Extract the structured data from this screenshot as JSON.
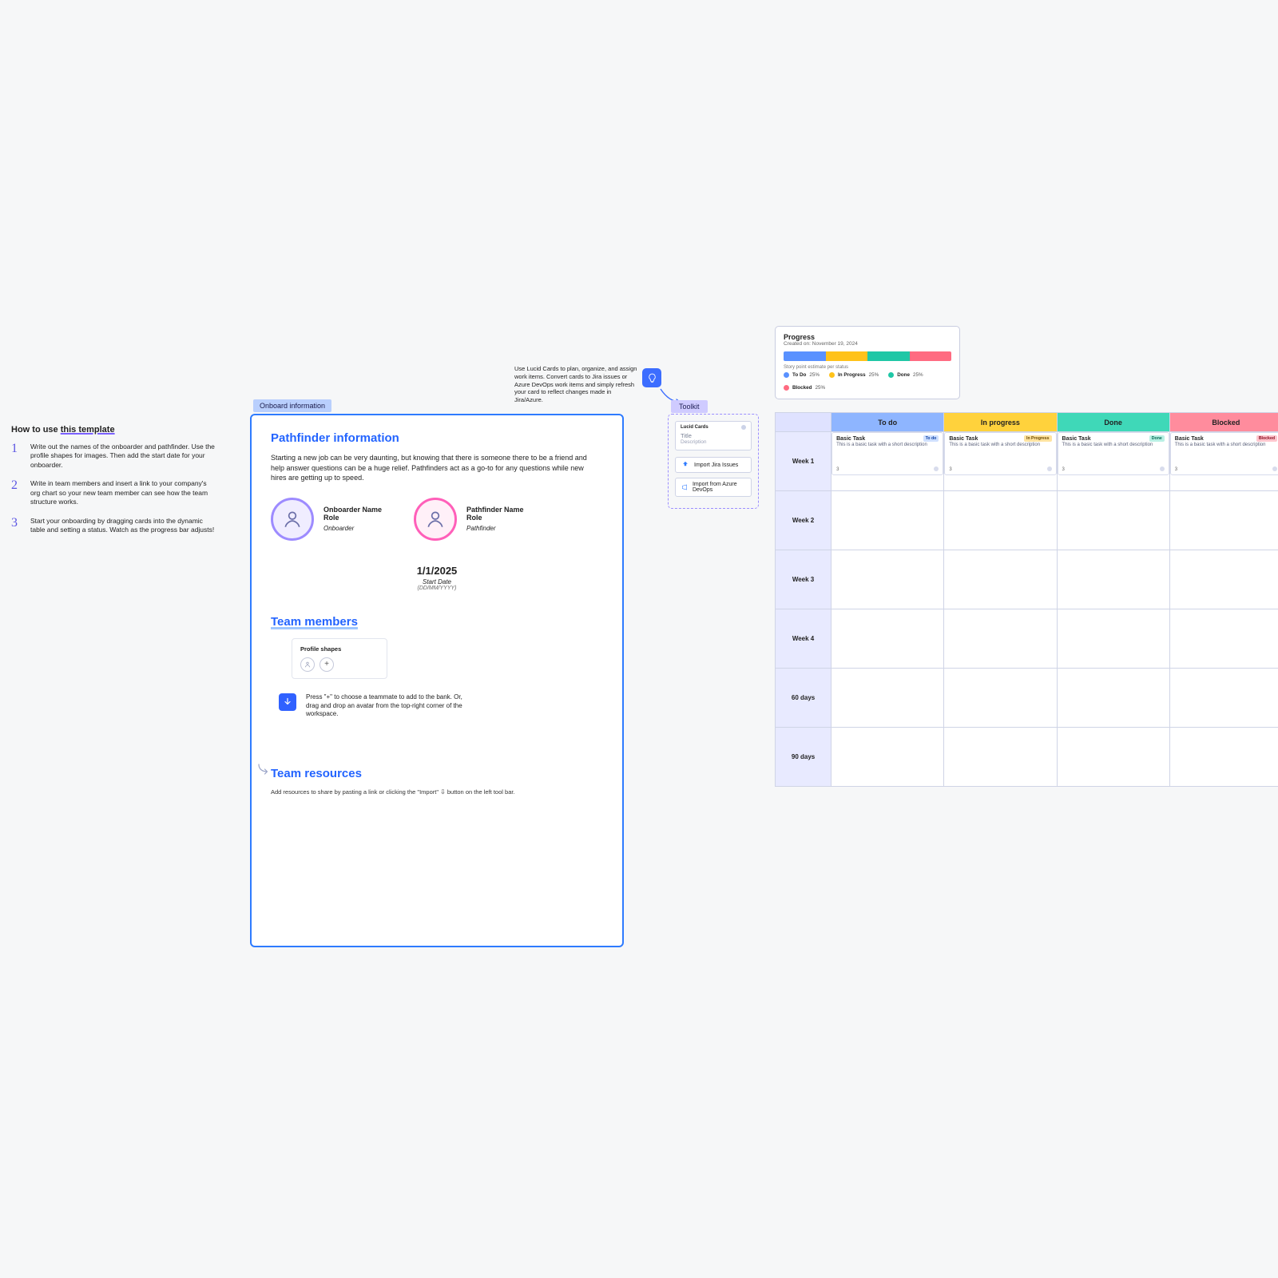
{
  "howto": {
    "title_prefix": "How to use ",
    "title_underlined": "this template",
    "steps": [
      {
        "num": "1",
        "text": "Write out the names of the onboarder and pathfinder. Use the profile shapes for images. Then add the start date for your onboarder."
      },
      {
        "num": "2",
        "text": "Write in team members and insert a link to your company's org chart so your new team member can see how the team structure works."
      },
      {
        "num": "3",
        "text": "Start your onboarding by dragging cards into the dynamic table and setting a status. Watch as the progress bar adjusts!"
      }
    ]
  },
  "onboard_tag": "Onboard information",
  "pathfinder": {
    "title": "Pathfinder information",
    "desc": "Starting a new job can be very daunting, but knowing that there is someone there to be a friend and help answer questions can be a huge relief. Pathfinders act as a go-to for any questions while new hires are getting up to speed."
  },
  "profiles": {
    "onboarder": {
      "name": "Onboarder Name",
      "role": "Role",
      "sub": "Onboarder"
    },
    "pathfinder": {
      "name": "Pathfinder Name",
      "role": "Role",
      "sub": "Pathfinder"
    }
  },
  "start_date": {
    "value": "1/1/2025",
    "label": "Start Date",
    "format": "(DD/MM/YYYY)"
  },
  "team_members": {
    "title": "Team members",
    "profile_shapes_label": "Profile shapes",
    "hint": "Press \"+\" to choose a teammate to add to the bank. Or, drag and drop an avatar from the top-right corner of the workspace."
  },
  "team_resources": {
    "title": "Team resources",
    "note_prefix": "Add resources to share by pasting a link or clicking the \"Import\" ",
    "note_suffix": " button on the left tool bar."
  },
  "toolkit": {
    "desc": "Use Lucid Cards to plan, organize, and assign work items. Convert cards to Jira issues or Azure DevOps work items and simply refresh your card to reflect changes made in Jira/Azure.",
    "tag": "Toolkit",
    "card": {
      "header": "Lucid Cards",
      "title": "Title",
      "desc": "Description"
    },
    "import_jira": "Import Jira Issues",
    "import_azure": "Import from Azure DevOps"
  },
  "progress": {
    "title": "Progress",
    "subtitle": "Created on: November 19, 2024",
    "note": "Story point estimate per status",
    "segments": {
      "todo": {
        "pct": 25,
        "label": "To Do",
        "value": "25%"
      },
      "inprogress": {
        "pct": 25,
        "label": "In Progress",
        "value": "25%"
      },
      "done": {
        "pct": 25,
        "label": "Done",
        "value": "25%"
      },
      "blocked": {
        "pct": 25,
        "label": "Blocked",
        "value": "25%"
      }
    }
  },
  "table": {
    "columns": [
      "To do",
      "In progress",
      "Done",
      "Blocked"
    ],
    "rows": [
      "Week 1",
      "Week 2",
      "Week 3",
      "Week 4",
      "60 days",
      "90 days"
    ],
    "card": {
      "title": "Basic Task",
      "body": "This is a basic task with a short description",
      "num": "3",
      "badges": {
        "todo": "To do",
        "inprogress": "In Progress",
        "done": "Done",
        "blocked": "Blocked"
      }
    }
  }
}
